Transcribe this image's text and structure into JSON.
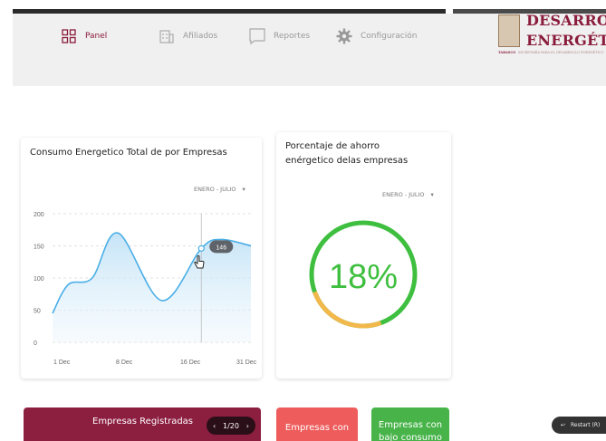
{
  "nav": {
    "items": [
      {
        "label": "Panel",
        "icon": "grid-icon"
      },
      {
        "label": "Afiliados",
        "icon": "building-icon"
      },
      {
        "label": "Reportes",
        "icon": "chat-icon"
      },
      {
        "label": "Configuración",
        "icon": "gear-icon"
      }
    ]
  },
  "logo": {
    "title_line1": "DESARROLLO",
    "title_line2": "ENERGÉTICO",
    "sub_left": "TABASCO",
    "sub_right": "SECRETARÍA PARA EL DESARROLLO ENERGÉTICO"
  },
  "consumo_card": {
    "title": "Consumo Energetico Total de por Empresas",
    "filter": "ENERO - JULIO",
    "tooltip": "146"
  },
  "ahorro_card": {
    "title_line1": "Porcentaje de ahorro",
    "title_line2": "enérgetico delas empresas",
    "filter": "ENERO - JULIO",
    "percent_text": "18%",
    "percent_value": 18
  },
  "bottom": {
    "registradas_label": "Empresas Registradas",
    "pager": "1/20",
    "con_label": "Empresas con",
    "con_bajo_label": "Empresas con",
    "con_bajo_line2": "bajo consumo",
    "restart_label": "Restart (R)"
  },
  "colors": {
    "brand": "#8a1c3c",
    "registradas_bg": "#8c1e40",
    "con_bg": "#ee5c5c",
    "con_bajo_bg": "#47b349",
    "gauge_green": "#3fbf3f",
    "gauge_orange": "#f2b84b",
    "line": "#4aaee6"
  },
  "chart_data": {
    "type": "area",
    "x_ticks": [
      "1 Dec",
      "8 Dec",
      "16 Dec",
      "31 Dec"
    ],
    "y_ticks": [
      0,
      50,
      100,
      150,
      200
    ],
    "ylim": [
      0,
      200
    ],
    "grid": true,
    "series": [
      {
        "x": [
          0,
          0.08,
          0.2,
          0.33,
          0.55,
          0.75,
          0.85,
          1
        ],
        "values": [
          45,
          90,
          100,
          170,
          65,
          146,
          160,
          150
        ]
      }
    ],
    "highlight": {
      "x": 0.75,
      "value": 146
    }
  }
}
